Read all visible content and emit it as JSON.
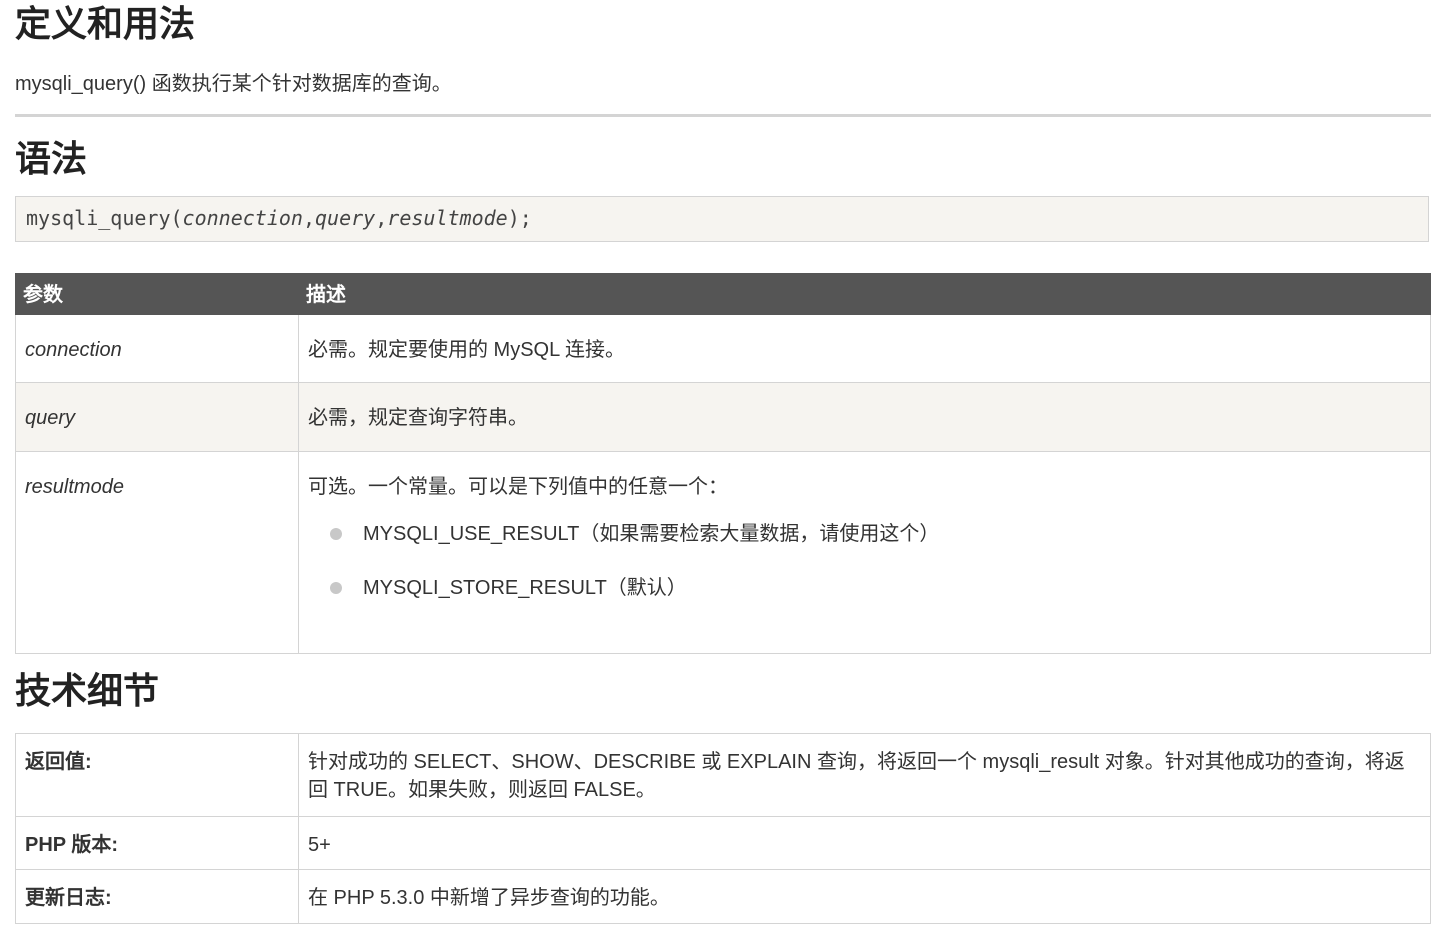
{
  "definition": {
    "heading": "定义和用法",
    "text": "mysqli_query() 函数执行某个针对数据库的查询。"
  },
  "syntax": {
    "heading": "语法",
    "code_prefix": "mysqli_query(",
    "param1": "connection",
    "sep1": ",",
    "param2": "query",
    "sep2": ",",
    "param3": "resultmode",
    "code_suffix": ");"
  },
  "params_table": {
    "headers": [
      "参数",
      "描述"
    ],
    "rows": [
      {
        "name": "connection",
        "desc": "必需。规定要使用的 MySQL 连接。"
      },
      {
        "name": "query",
        "desc": "必需，规定查询字符串。"
      },
      {
        "name": "resultmode",
        "desc": "可选。一个常量。可以是下列值中的任意一个：",
        "options": [
          "MYSQLI_USE_RESULT（如果需要检索大量数据，请使用这个）",
          "MYSQLI_STORE_RESULT（默认）"
        ]
      }
    ]
  },
  "technical": {
    "heading": "技术细节",
    "rows": [
      {
        "label": "返回值:",
        "value": "针对成功的 SELECT、SHOW、DESCRIBE 或 EXPLAIN 查询，将返回一个 mysqli_result 对象。针对其他成功的查询，将返回 TRUE。如果失败，则返回 FALSE。"
      },
      {
        "label": "PHP 版本:",
        "value": "5+"
      },
      {
        "label": "更新日志:",
        "value": "在 PHP 5.3.0 中新增了异步查询的功能。"
      }
    ]
  }
}
